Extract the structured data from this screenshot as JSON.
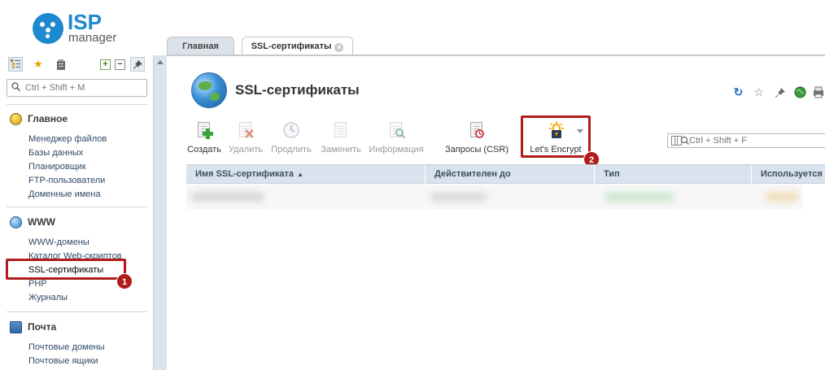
{
  "app": {
    "logo_main": "ISP",
    "logo_sub": "manager"
  },
  "sidebar": {
    "search_placeholder": "Ctrl + Shift + M",
    "sections": [
      {
        "title": "Главное",
        "icon": "home-icon",
        "items": [
          "Менеджер файлов",
          "Базы данных",
          "Планировщик",
          "FTP-пользователи",
          "Доменные имена"
        ]
      },
      {
        "title": "WWW",
        "icon": "www-globe-icon",
        "items": [
          "WWW-домены",
          "Каталог Web-скриптов",
          "SSL-сертификаты",
          "PHP",
          "Журналы"
        ]
      },
      {
        "title": "Почта",
        "icon": "mail-icon",
        "items": [
          "Почтовые домены",
          "Почтовые ящики"
        ]
      }
    ]
  },
  "tabs": [
    {
      "label": "Главная",
      "active": false
    },
    {
      "label": "SSL-сертификаты",
      "active": true
    }
  ],
  "main": {
    "title": "SSL-сертификаты",
    "toolbar": [
      {
        "label": "Создать",
        "enabled": true,
        "icon": "create-certificate-icon"
      },
      {
        "label": "Удалить",
        "enabled": false,
        "icon": "delete-icon"
      },
      {
        "label": "Продлить",
        "enabled": false,
        "icon": "renew-icon"
      },
      {
        "label": "Заменить",
        "enabled": false,
        "icon": "replace-icon"
      },
      {
        "label": "Информация",
        "enabled": false,
        "icon": "info-icon"
      },
      {
        "label": "Запросы (CSR)",
        "enabled": true,
        "icon": "csr-icon"
      },
      {
        "label": "Let's Encrypt",
        "enabled": true,
        "icon": "lock-icon"
      }
    ],
    "grid_search_placeholder": "Ctrl + Shift + F",
    "columns": [
      "Имя SSL-сертификата",
      "Действителен до",
      "Тип",
      "Используется"
    ]
  },
  "annotations": {
    "badge1": "1",
    "badge2": "2"
  },
  "colors": {
    "accent": "#1e88d0",
    "highlight": "#b11b1b",
    "header_bg": "#d9e3ee"
  }
}
